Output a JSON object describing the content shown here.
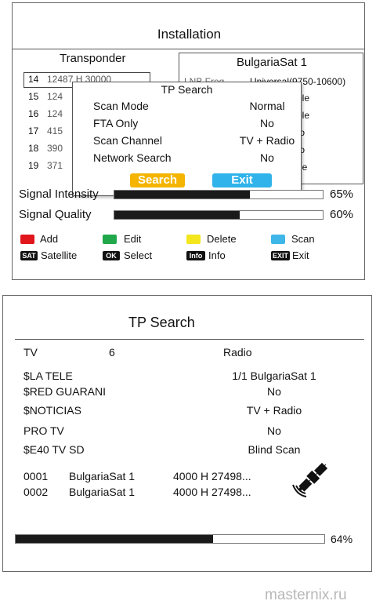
{
  "screen1": {
    "title": "Installation",
    "left_header": "Transponder",
    "right_header": "BulgariaSat 1",
    "transponders": [
      {
        "num": "14",
        "freq": "12487 H 30000"
      },
      {
        "num": "15",
        "freq": "124"
      },
      {
        "num": "16",
        "freq": "124"
      },
      {
        "num": "17",
        "freq": "415"
      },
      {
        "num": "18",
        "freq": "390"
      },
      {
        "num": "19",
        "freq": "371"
      }
    ],
    "lnb_label": "LNB Freq",
    "lnb_value": "Universal(9750-10600)",
    "right_fragments": [
      "ble",
      "ble",
      "to",
      "to",
      "ne"
    ],
    "popup": {
      "title": "TP Search",
      "rows": [
        {
          "label": "Scan Mode",
          "value": "Normal"
        },
        {
          "label": "FTA Only",
          "value": "No"
        },
        {
          "label": "Scan Channel",
          "value": "TV + Radio"
        },
        {
          "label": "Network Search",
          "value": "No"
        }
      ],
      "search_label": "Search",
      "exit_label": "Exit"
    },
    "signal_intensity": {
      "label": "Signal Intensity",
      "percent_text": "65%",
      "fraction": 0.65
    },
    "signal_quality": {
      "label": "Signal Quality",
      "percent_text": "60%",
      "fraction": 0.6
    },
    "legend": {
      "add": "Add",
      "edit": "Edit",
      "delete": "Delete",
      "scan": "Scan",
      "sat_key": "SAT",
      "satellite": "Satellite",
      "ok_key": "OK",
      "select": "Select",
      "info_key": "Info",
      "info": "Info",
      "exit_key": "EXIT",
      "exit": "Exit"
    },
    "colors": {
      "red": "#e0161c",
      "green": "#20a84a",
      "yellow": "#f3e61d",
      "blue": "#3fb6e8",
      "popup_search": "#f4b400",
      "popup_exit": "#2fb3ea"
    }
  },
  "screen2": {
    "title": "TP Search",
    "tv_label": "TV",
    "tv_count": "6",
    "radio_label": "Radio",
    "channels": [
      "$LA TELE",
      "$RED GUARANI",
      "$NOTICIAS",
      "PRO TV",
      "$E40 TV SD"
    ],
    "info_values": [
      "1/1 BulgariaSat 1",
      "No",
      "TV + Radio",
      "No",
      "Blind Scan"
    ],
    "results": [
      {
        "num": "0001",
        "sat": "BulgariaSat 1",
        "tp": "4000 H 27498..."
      },
      {
        "num": "0002",
        "sat": "BulgariaSat 1",
        "tp": "4000 H 27498..."
      }
    ],
    "progress_text": "64%",
    "progress_fraction": 0.64,
    "satellite_icon": "satellite-icon"
  },
  "watermark": "masternix.ru"
}
